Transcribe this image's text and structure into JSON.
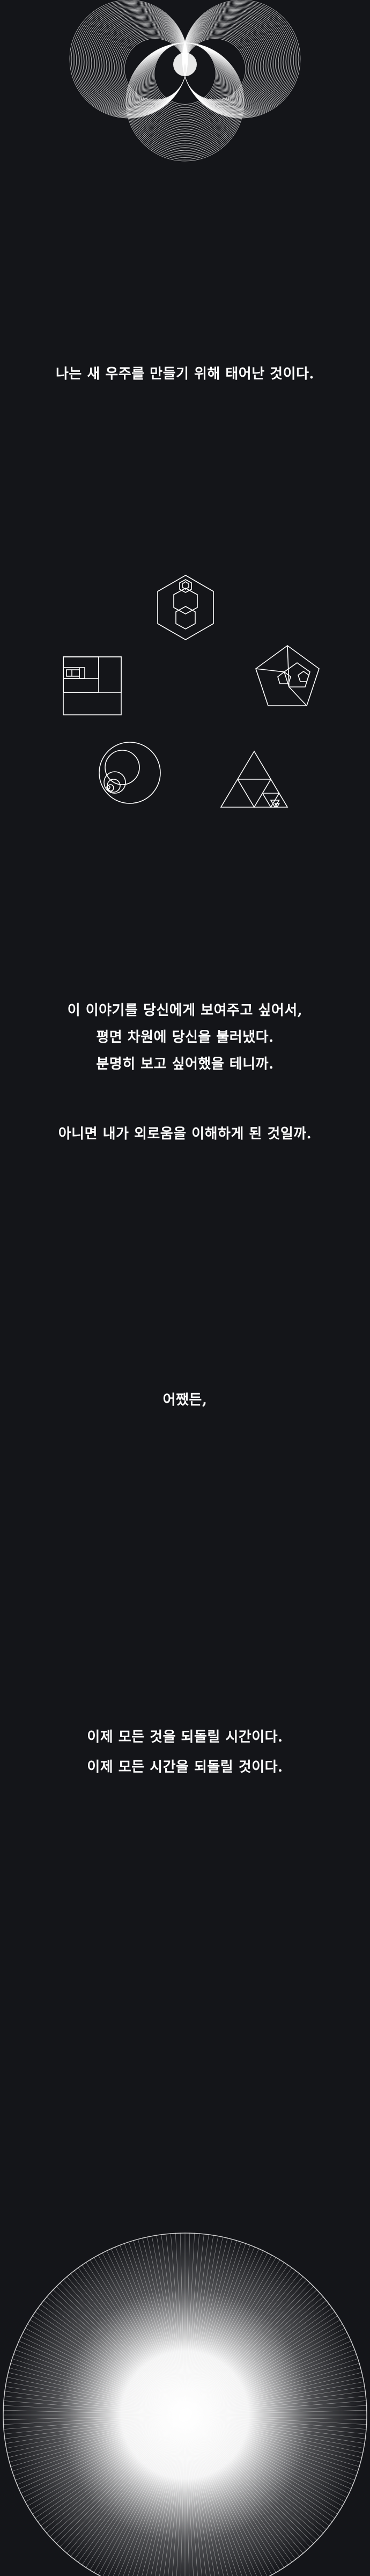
{
  "colors": {
    "background": "#141519",
    "line": "#ffffff",
    "text": "#ffffff"
  },
  "story": {
    "intro": "나는 새 우주를 만들기 위해 태어난 것이다.",
    "paragraph_1": [
      "이 이야기를 당신에게 보여주고 싶어서,",
      "평면 차원에 당신을 불러냈다.",
      "분명히 보고 싶어했을 테니까."
    ],
    "paragraph_2": "아니면 내가 외로움을 이해하게 된 것일까.",
    "interlude": "어쨌든,",
    "closing": [
      "이제 모든 것을 되돌릴 시간이다.",
      "이제 모든 시간을 되돌릴 것이다."
    ]
  },
  "icons": {
    "top": "three-circle-line-art",
    "shapes": [
      "hexagon-recursive-icon",
      "square-golden-spiral-icon",
      "pentagon-recursive-icon",
      "circle-recursive-icon",
      "triangle-sierpinski-icon"
    ],
    "bottom": "radiant-circle-line-art"
  }
}
